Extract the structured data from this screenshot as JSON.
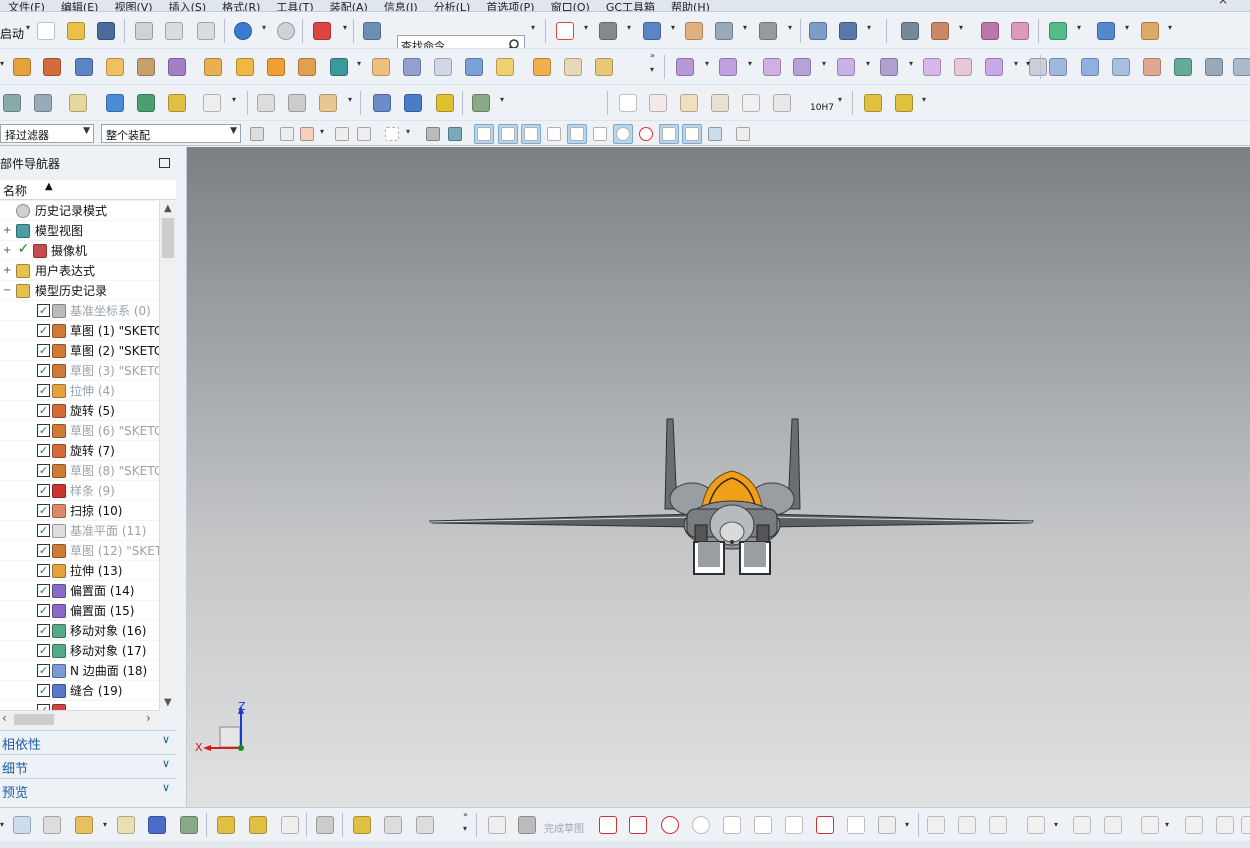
{
  "menu": {
    "items": [
      "文件(F)",
      "编辑(E)",
      "视图(V)",
      "插入(S)",
      "格式(R)",
      "工具(T)",
      "装配(A)",
      "信息(I)",
      "分析(L)",
      "首选项(P)",
      "窗口(O)",
      "GC工具箱",
      "帮助(H)"
    ],
    "close": "×"
  },
  "toolbar": {
    "start_label": "启动",
    "search_placeholder": "查找命令"
  },
  "filter": {
    "selection_filter": "择过滤器",
    "assembly_scope": "整个装配"
  },
  "navigator": {
    "title": "部件导航器",
    "column_name": "名称",
    "rows": [
      {
        "label": "历史记录模式",
        "icon": "clock-icon",
        "check": false,
        "expander": "",
        "dim": false,
        "indent": 0
      },
      {
        "label": "模型视图",
        "icon": "model-views-icon",
        "check": false,
        "expander": "+",
        "dim": false,
        "indent": 0
      },
      {
        "label": "摄像机",
        "icon": "camera-icon",
        "check": true,
        "expander": "+",
        "dim": false,
        "indent": 0
      },
      {
        "label": "用户表达式",
        "icon": "folder-icon",
        "check": false,
        "expander": "+",
        "dim": false,
        "indent": 0
      },
      {
        "label": "模型历史记录",
        "icon": "folder-open-icon",
        "check": false,
        "expander": "−",
        "dim": false,
        "indent": 0
      },
      {
        "label": "基准坐标系 (0)",
        "icon": "datum-csys-icon",
        "check": true,
        "expander": "",
        "dim": true,
        "indent": 1
      },
      {
        "label": "草图 (1) \"SKETC",
        "icon": "sketch-icon",
        "check": true,
        "expander": "",
        "dim": false,
        "indent": 1
      },
      {
        "label": "草图 (2) \"SKETC",
        "icon": "sketch-icon",
        "check": true,
        "expander": "",
        "dim": false,
        "indent": 1
      },
      {
        "label": "草图 (3) \"SKETC",
        "icon": "sketch-icon",
        "check": true,
        "expander": "",
        "dim": true,
        "indent": 1
      },
      {
        "label": "拉伸 (4)",
        "icon": "extrude-icon",
        "check": true,
        "expander": "",
        "dim": true,
        "indent": 1
      },
      {
        "label": "旋转 (5)",
        "icon": "revolve-icon",
        "check": true,
        "expander": "",
        "dim": false,
        "indent": 1
      },
      {
        "label": "草图 (6) \"SKETC",
        "icon": "sketch-icon",
        "check": true,
        "expander": "",
        "dim": true,
        "indent": 1
      },
      {
        "label": "旋转 (7)",
        "icon": "revolve-icon",
        "check": true,
        "expander": "",
        "dim": false,
        "indent": 1
      },
      {
        "label": "草图 (8) \"SKETC",
        "icon": "sketch-icon",
        "check": true,
        "expander": "",
        "dim": true,
        "indent": 1
      },
      {
        "label": "样条 (9)",
        "icon": "spline-icon",
        "check": true,
        "expander": "",
        "dim": true,
        "indent": 1
      },
      {
        "label": "扫掠 (10)",
        "icon": "swept-icon",
        "check": true,
        "expander": "",
        "dim": false,
        "indent": 1
      },
      {
        "label": "基准平面 (11)",
        "icon": "datum-plane-icon",
        "check": true,
        "expander": "",
        "dim": true,
        "indent": 1
      },
      {
        "label": "草图 (12) \"SKET",
        "icon": "sketch-icon",
        "check": true,
        "expander": "",
        "dim": true,
        "indent": 1
      },
      {
        "label": "拉伸 (13)",
        "icon": "extrude-icon",
        "check": true,
        "expander": "",
        "dim": false,
        "indent": 1
      },
      {
        "label": "偏置面 (14)",
        "icon": "offset-face-icon",
        "check": true,
        "expander": "",
        "dim": false,
        "indent": 1
      },
      {
        "label": "偏置面 (15)",
        "icon": "offset-face-icon",
        "check": true,
        "expander": "",
        "dim": false,
        "indent": 1
      },
      {
        "label": "移动对象 (16)",
        "icon": "move-object-icon",
        "check": true,
        "expander": "",
        "dim": false,
        "indent": 1
      },
      {
        "label": "移动对象 (17)",
        "icon": "move-object-icon",
        "check": true,
        "expander": "",
        "dim": false,
        "indent": 1
      },
      {
        "label": "N 边曲面 (18)",
        "icon": "n-sided-surface-icon",
        "check": true,
        "expander": "",
        "dim": false,
        "indent": 1
      },
      {
        "label": "缝合 (19)",
        "icon": "sew-icon",
        "check": true,
        "expander": "",
        "dim": false,
        "indent": 1
      },
      {
        "label": "",
        "icon": "feature-icon",
        "check": true,
        "expander": "",
        "dim": false,
        "indent": 1
      }
    ],
    "sections": [
      {
        "label": "相依性"
      },
      {
        "label": "细节"
      },
      {
        "label": "预览"
      }
    ]
  },
  "sketch": {
    "finish_label": "完成草图"
  },
  "dim_text": "10H7",
  "triad": {
    "z_label": "Z",
    "x_label": "X"
  },
  "colors": {
    "accent": "#1a5ea8",
    "viewport_top": "#7c8083",
    "viewport_bottom": "#e0e1e2",
    "canopy": "#f0a018",
    "body": "#8a8e92"
  }
}
